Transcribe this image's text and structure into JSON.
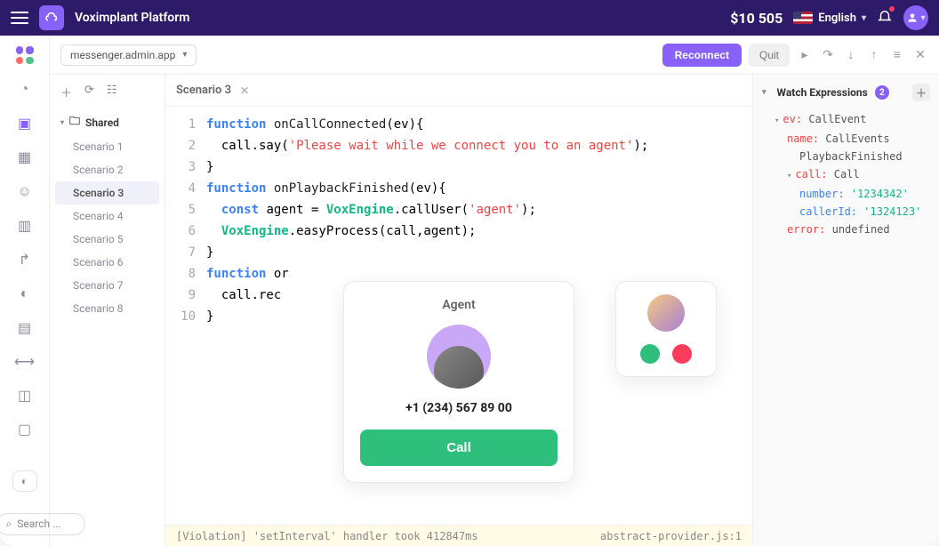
{
  "topbar": {
    "brand": "Voximplant Platform",
    "balance": "$10 505",
    "language": "English"
  },
  "toolbar": {
    "app_name": "messenger.admin.app",
    "reconnect": "Reconnect",
    "quit": "Quit"
  },
  "sidebar": {
    "folder": "Shared",
    "scenarios": [
      "Scenario 1",
      "Scenario 2",
      "Scenario 3",
      "Scenario 4",
      "Scenario 5",
      "Scenario 6",
      "Scenario 7",
      "Scenario 8"
    ],
    "selected_index": 2
  },
  "search": {
    "placeholder": "Search ..."
  },
  "tab": {
    "label": "Scenario 3"
  },
  "code": {
    "lines": [
      {
        "n": 1,
        "html": "<span class='kw'>function</span> <span class='id'>onCallConnected</span>(ev){"
      },
      {
        "n": 2,
        "html": "  call.say(<span class='str'>'Please wait while we connect you to an agent'</span>);"
      },
      {
        "n": 3,
        "html": "}"
      },
      {
        "n": 4,
        "html": "<span class='kw'>function</span> <span class='id'>onPlaybackFinished</span>(ev){"
      },
      {
        "n": 5,
        "html": "  <span class='kw'>const</span> agent = <span class='fn'>VoxEngine</span>.callUser(<span class='str'>'agent'</span>);"
      },
      {
        "n": 6,
        "html": "  <span class='fn'>VoxEngine</span>.easyProcess(call,agent);"
      },
      {
        "n": 7,
        "html": "}"
      },
      {
        "n": 8,
        "html": "<span class='kw'>function</span> or"
      },
      {
        "n": 9,
        "html": "  call.rec                                ue});"
      },
      {
        "n": 10,
        "html": "}"
      }
    ]
  },
  "watch": {
    "title": "Watch Expressions",
    "count": "2",
    "ev_label": "ev:",
    "ev_type": "CallEvent",
    "name_label": "name:",
    "name_value": "CallEvents",
    "playback": "PlaybackFinished",
    "call_label": "call:",
    "call_type": "Call",
    "number_label": "number:",
    "number_value": "'1234342'",
    "callerid_label": "callerId:",
    "callerid_value": "'1324123'",
    "error_label": "error:",
    "error_value": "undefined"
  },
  "agent_popup": {
    "title": "Agent",
    "phone": "+1 (234) 567 89 00",
    "call_btn": "Call"
  },
  "console": {
    "left": "[Violation] 'setInterval' handler took 412847ms",
    "right": "abstract-provider.js:1"
  }
}
